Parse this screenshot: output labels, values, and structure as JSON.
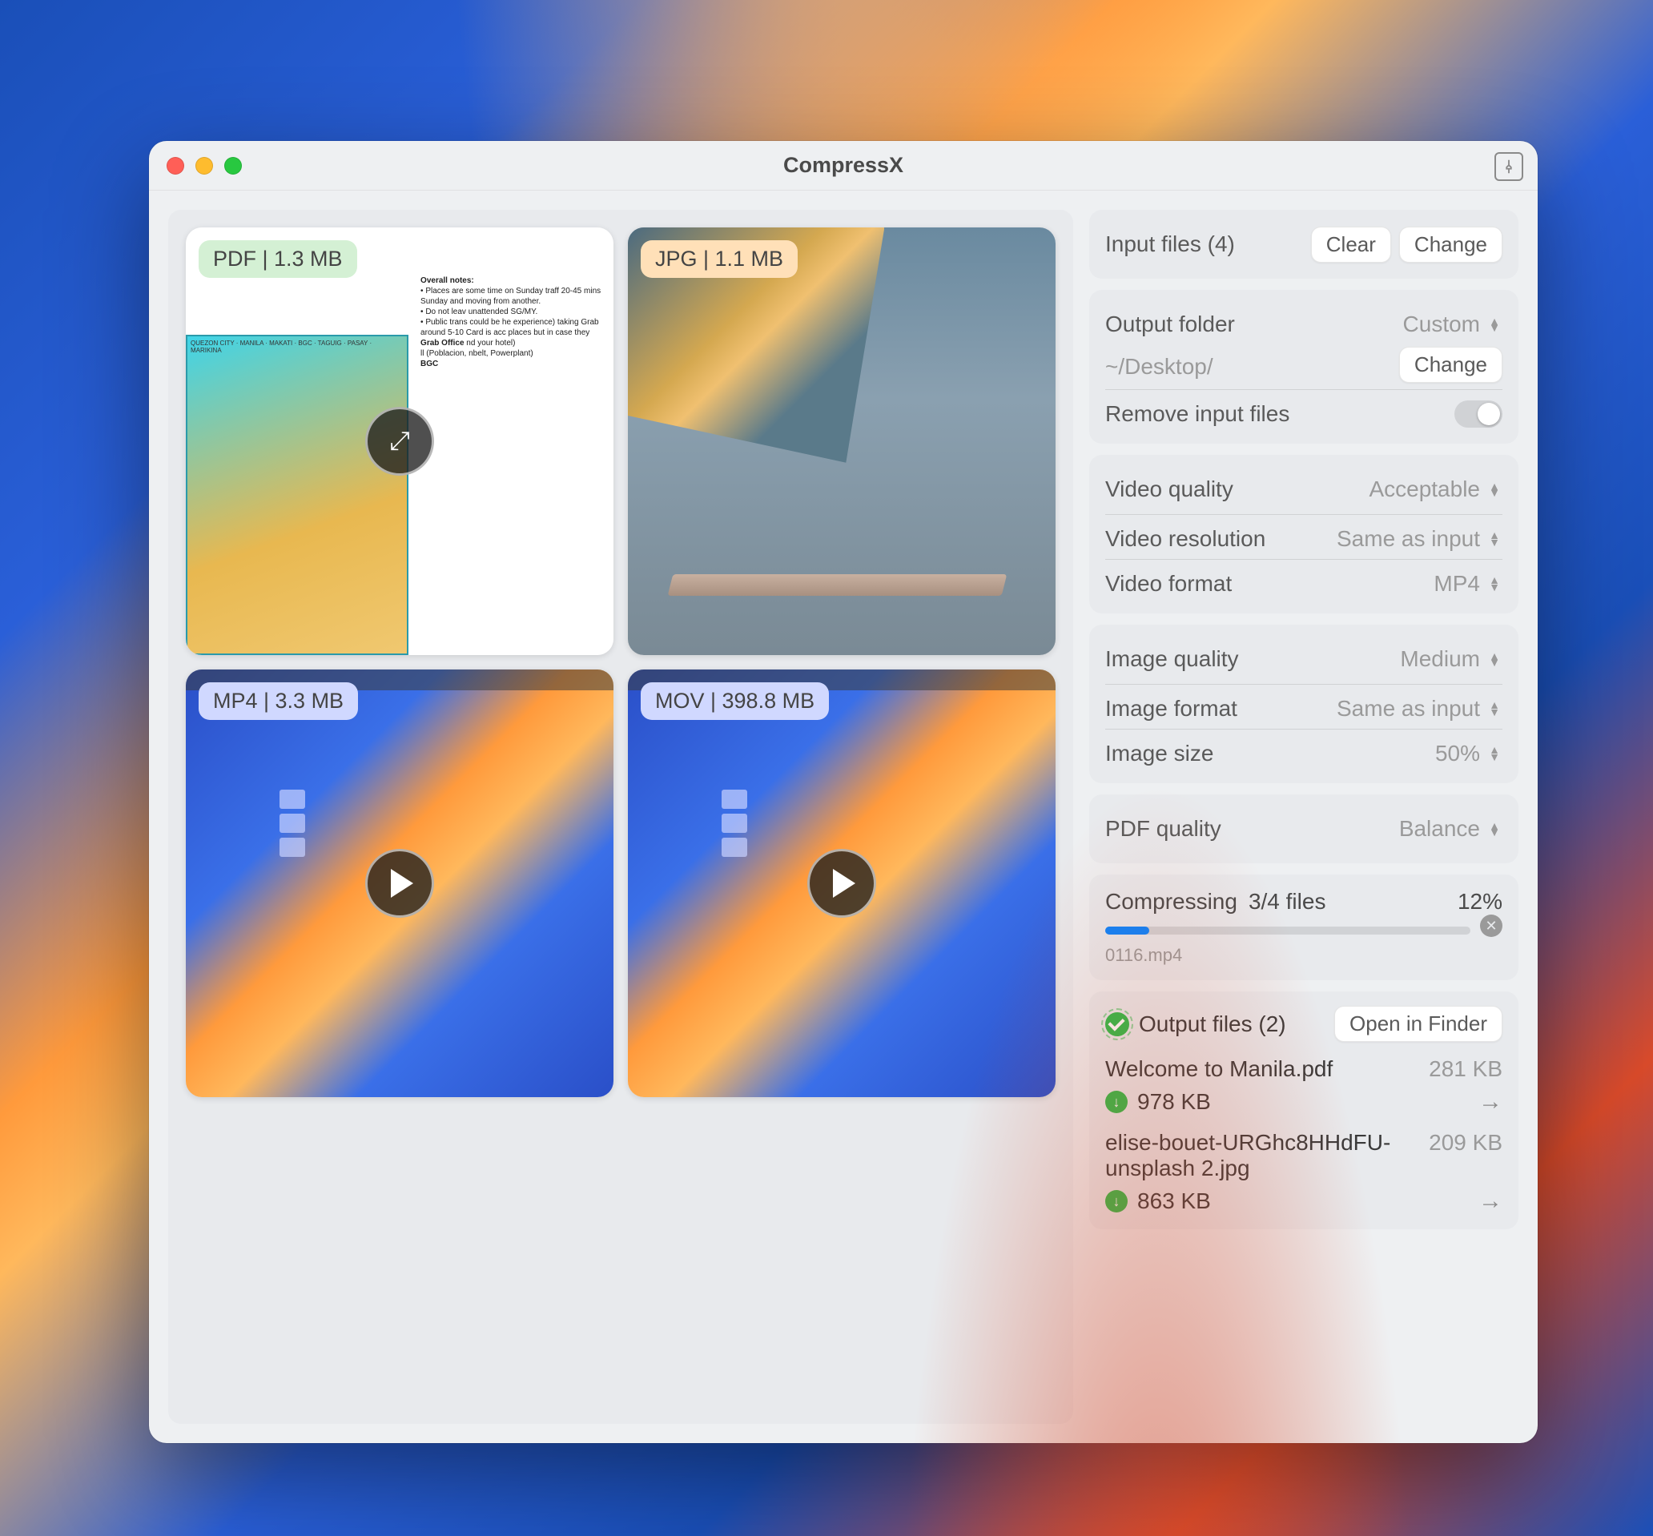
{
  "window": {
    "title": "CompressX"
  },
  "thumbs": [
    {
      "type": "PDF",
      "badge": "PDF | 1.3 MB",
      "overlay": "expand"
    },
    {
      "type": "JPG",
      "badge": "JPG | 1.1 MB",
      "overlay": "none"
    },
    {
      "type": "MP4",
      "badge": "MP4 | 3.3 MB",
      "overlay": "play"
    },
    {
      "type": "MOV",
      "badge": "MOV | 398.8 MB",
      "overlay": "play"
    }
  ],
  "input": {
    "label": "Input files (4)",
    "clear": "Clear",
    "change": "Change"
  },
  "output": {
    "label": "Output folder",
    "mode": "Custom",
    "path": "~/Desktop/",
    "change": "Change",
    "remove_label": "Remove input files",
    "remove_enabled": false
  },
  "video": {
    "quality_label": "Video quality",
    "quality_value": "Acceptable",
    "resolution_label": "Video resolution",
    "resolution_value": "Same as input",
    "format_label": "Video format",
    "format_value": "MP4"
  },
  "image": {
    "quality_label": "Image quality",
    "quality_value": "Medium",
    "format_label": "Image format",
    "format_value": "Same as input",
    "size_label": "Image size",
    "size_value": "50%"
  },
  "pdf": {
    "quality_label": "PDF quality",
    "quality_value": "Balance"
  },
  "progress": {
    "status": "Compressing",
    "count": "3/4 files",
    "percent": "12%",
    "percent_num": 12,
    "current_file": "0116.mp4"
  },
  "results": {
    "label": "Output files (2)",
    "open_button": "Open in Finder",
    "items": [
      {
        "name": "Welcome to Manila.pdf",
        "orig": "281 KB",
        "new": "978 KB"
      },
      {
        "name": "elise-bouet-URGhc8HHdFU-unsplash 2.jpg",
        "orig": "209 KB",
        "new": "863 KB"
      }
    ]
  }
}
